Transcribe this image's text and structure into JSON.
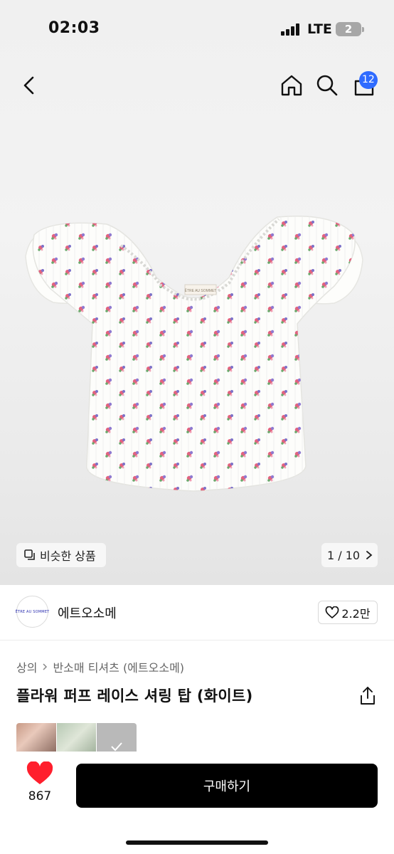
{
  "status_bar": {
    "time": "02:03",
    "network": "LTE",
    "battery": "2"
  },
  "nav": {
    "cart_badge": "12"
  },
  "product_image": {
    "label": "ÊTRE AU SOMMET"
  },
  "gallery": {
    "similar_label": "비슷한 상품",
    "counter": "1 / 10"
  },
  "store": {
    "logo_text": "ÊTRE AU SOMMET",
    "name": "에트오소메",
    "likes": "2.2만"
  },
  "breadcrumb": [
    "상의",
    "반소매 티셔츠 (에트오소메)"
  ],
  "product": {
    "title": "플라워 퍼프 레이스 셔링 탑 (화이트)"
  },
  "bottom": {
    "heart_count": "867",
    "buy_label": "구매하기"
  },
  "colors": {
    "accent_blue": "#2f6bff",
    "heart_red": "#ff1f2d",
    "buy_bg": "#000000"
  },
  "icons": [
    "back-icon",
    "home-icon",
    "search-icon",
    "cart-icon",
    "copy-icon",
    "chevron-right-icon",
    "heart-outline-icon",
    "share-icon",
    "heart-filled-icon"
  ]
}
